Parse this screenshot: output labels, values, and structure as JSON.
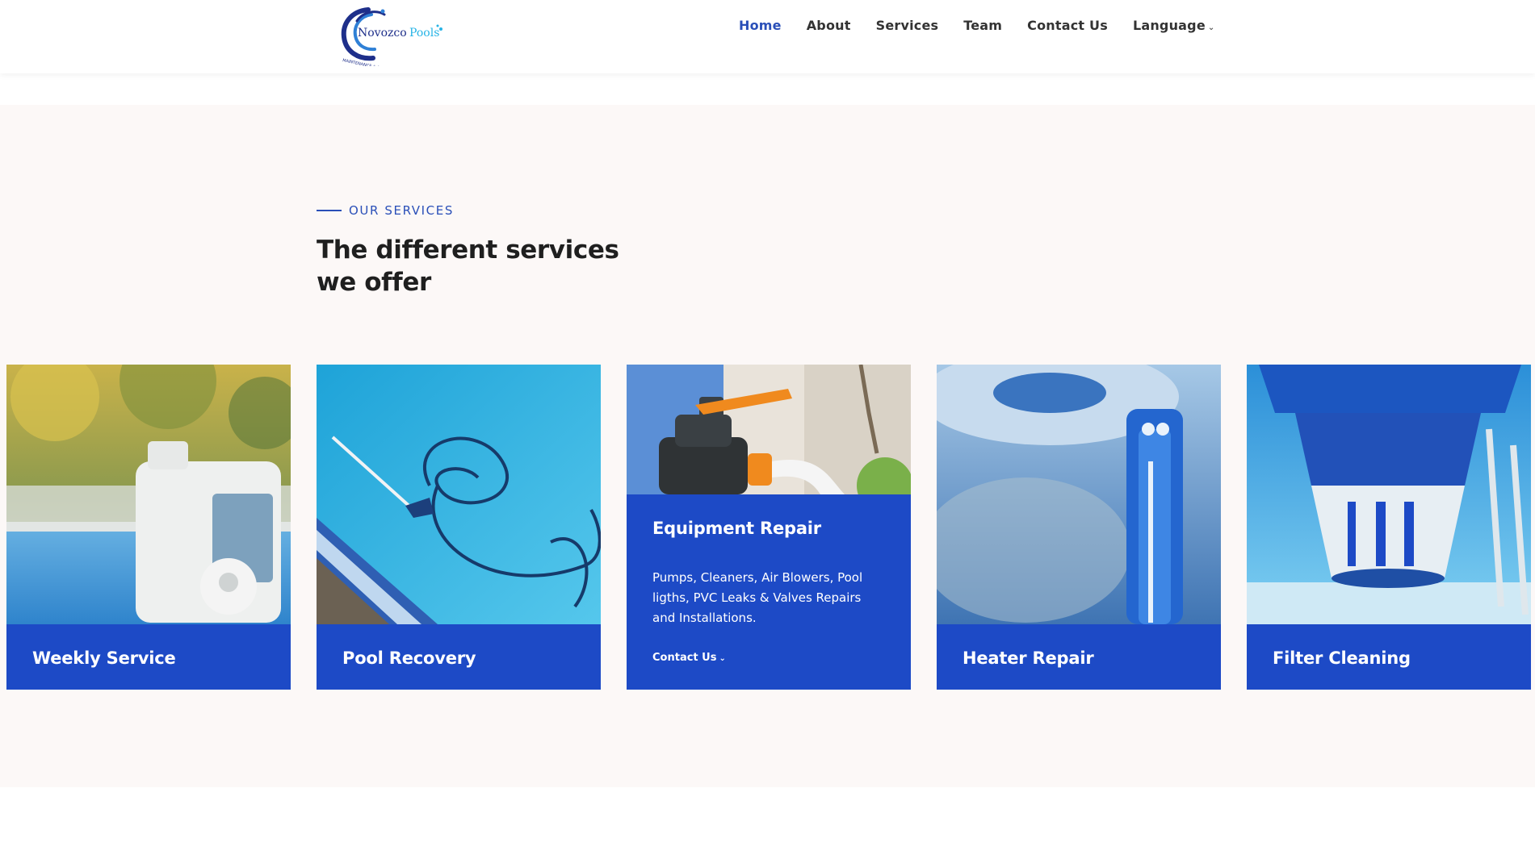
{
  "brand": {
    "name": "Novozco Pools",
    "tagline": "MAINTENANCE & REPAIR"
  },
  "nav": {
    "items": [
      "Home",
      "About",
      "Services",
      "Team",
      "Contact Us",
      "Language"
    ],
    "active": "Home"
  },
  "services": {
    "eyebrow": "OUR SERVICES",
    "title": "The different services we offer",
    "cards": [
      {
        "label": "Weekly Service"
      },
      {
        "label": "Pool Recovery"
      },
      {
        "label": "Equipment Repair",
        "description": "Pumps, Cleaners, Air Blowers, Pool ligths, PVC Leaks & Valves Repairs and Installations.",
        "link": "Contact Us"
      },
      {
        "label": "Heater Repair"
      },
      {
        "label": "Filter Cleaning"
      }
    ]
  },
  "colors": {
    "accent": "#2a4fb8",
    "card_blue": "#1d4ac6",
    "section_bg": "#fcf8f7"
  },
  "icons": [
    "chevron-down-icon"
  ]
}
